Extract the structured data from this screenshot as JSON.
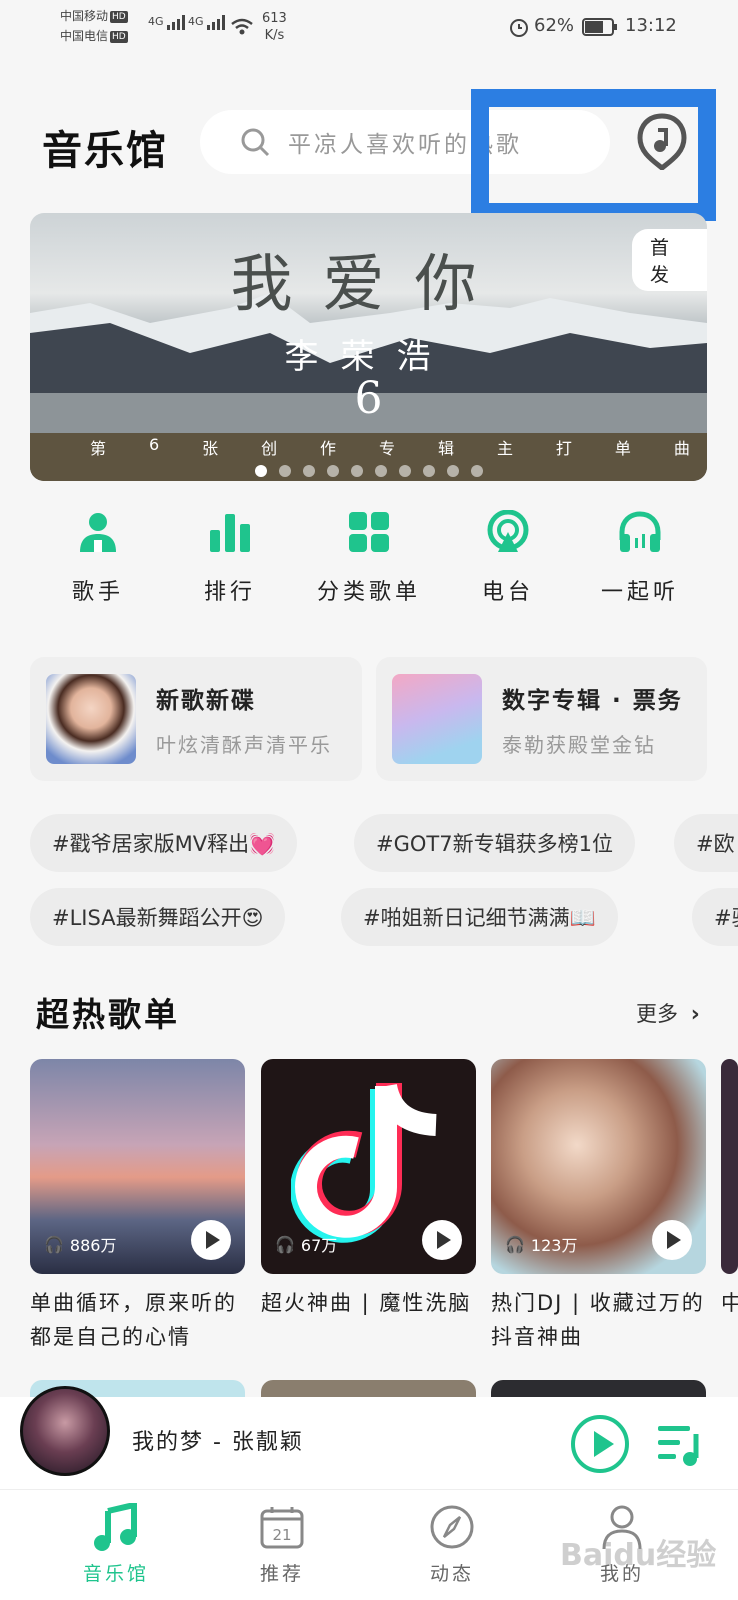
{
  "status_bar": {
    "carrier1": "中国移动",
    "carrier2": "中国电信",
    "hd": "HD",
    "network": "4G",
    "net_speed_value": "613",
    "net_speed_unit": "K/s",
    "battery": "62%",
    "time": "13:12"
  },
  "header": {
    "title": "音乐馆",
    "search_placeholder": "平凉人喜欢听的热歌"
  },
  "banner": {
    "title": "我爱你",
    "artist": "李荣浩",
    "number": "6",
    "subtitle_chars": [
      "第",
      "6",
      "张",
      "创",
      "作",
      "专",
      "辑",
      "主",
      "打",
      "单",
      "曲"
    ],
    "badge": "首发",
    "dots_count": 10,
    "active_dot": 0
  },
  "categories": [
    {
      "label": "歌手",
      "icon": "singer-icon"
    },
    {
      "label": "排行",
      "icon": "chart-icon"
    },
    {
      "label": "分类歌单",
      "icon": "grid-icon"
    },
    {
      "label": "电台",
      "icon": "radio-icon"
    },
    {
      "label": "一起听",
      "icon": "headphones-icon"
    }
  ],
  "promo_cards": [
    {
      "title": "新歌新碟",
      "subtitle": "叶炫清酥声清平乐"
    },
    {
      "title": "数字专辑 · 票务",
      "subtitle": "泰勒获殿堂金钻"
    }
  ],
  "tags": {
    "row1": [
      "#戳爷居家版MV释出💓",
      "#GOT7新专辑获多榜1位",
      "#欧"
    ],
    "row2": [
      "#LISA最新舞蹈公开😍",
      "#啪姐新日记细节满满📖",
      "#驰"
    ]
  },
  "section": {
    "title": "超热歌单",
    "more": "更多"
  },
  "playlists": [
    {
      "count": "886万",
      "title": "单曲循环，原来听的都是自己的心情"
    },
    {
      "count": "67万",
      "title": "超火神曲 | 魔性洗脑"
    },
    {
      "count": "123万",
      "title": "热门DJ | 收藏过万的抖音神曲"
    },
    {
      "count": "",
      "title": "中"
    }
  ],
  "player": {
    "now_playing": "我的梦 - 张靓颖"
  },
  "bottom_nav": [
    {
      "label": "音乐馆",
      "active": true
    },
    {
      "label": "推荐",
      "active": false,
      "icon_text": "21"
    },
    {
      "label": "动态",
      "active": false
    },
    {
      "label": "我的",
      "active": false
    }
  ],
  "watermark": "Baidu经验",
  "colors": {
    "accent": "#1fc48d",
    "highlight_box": "#2c7ee2",
    "background": "#f6f6f6"
  }
}
